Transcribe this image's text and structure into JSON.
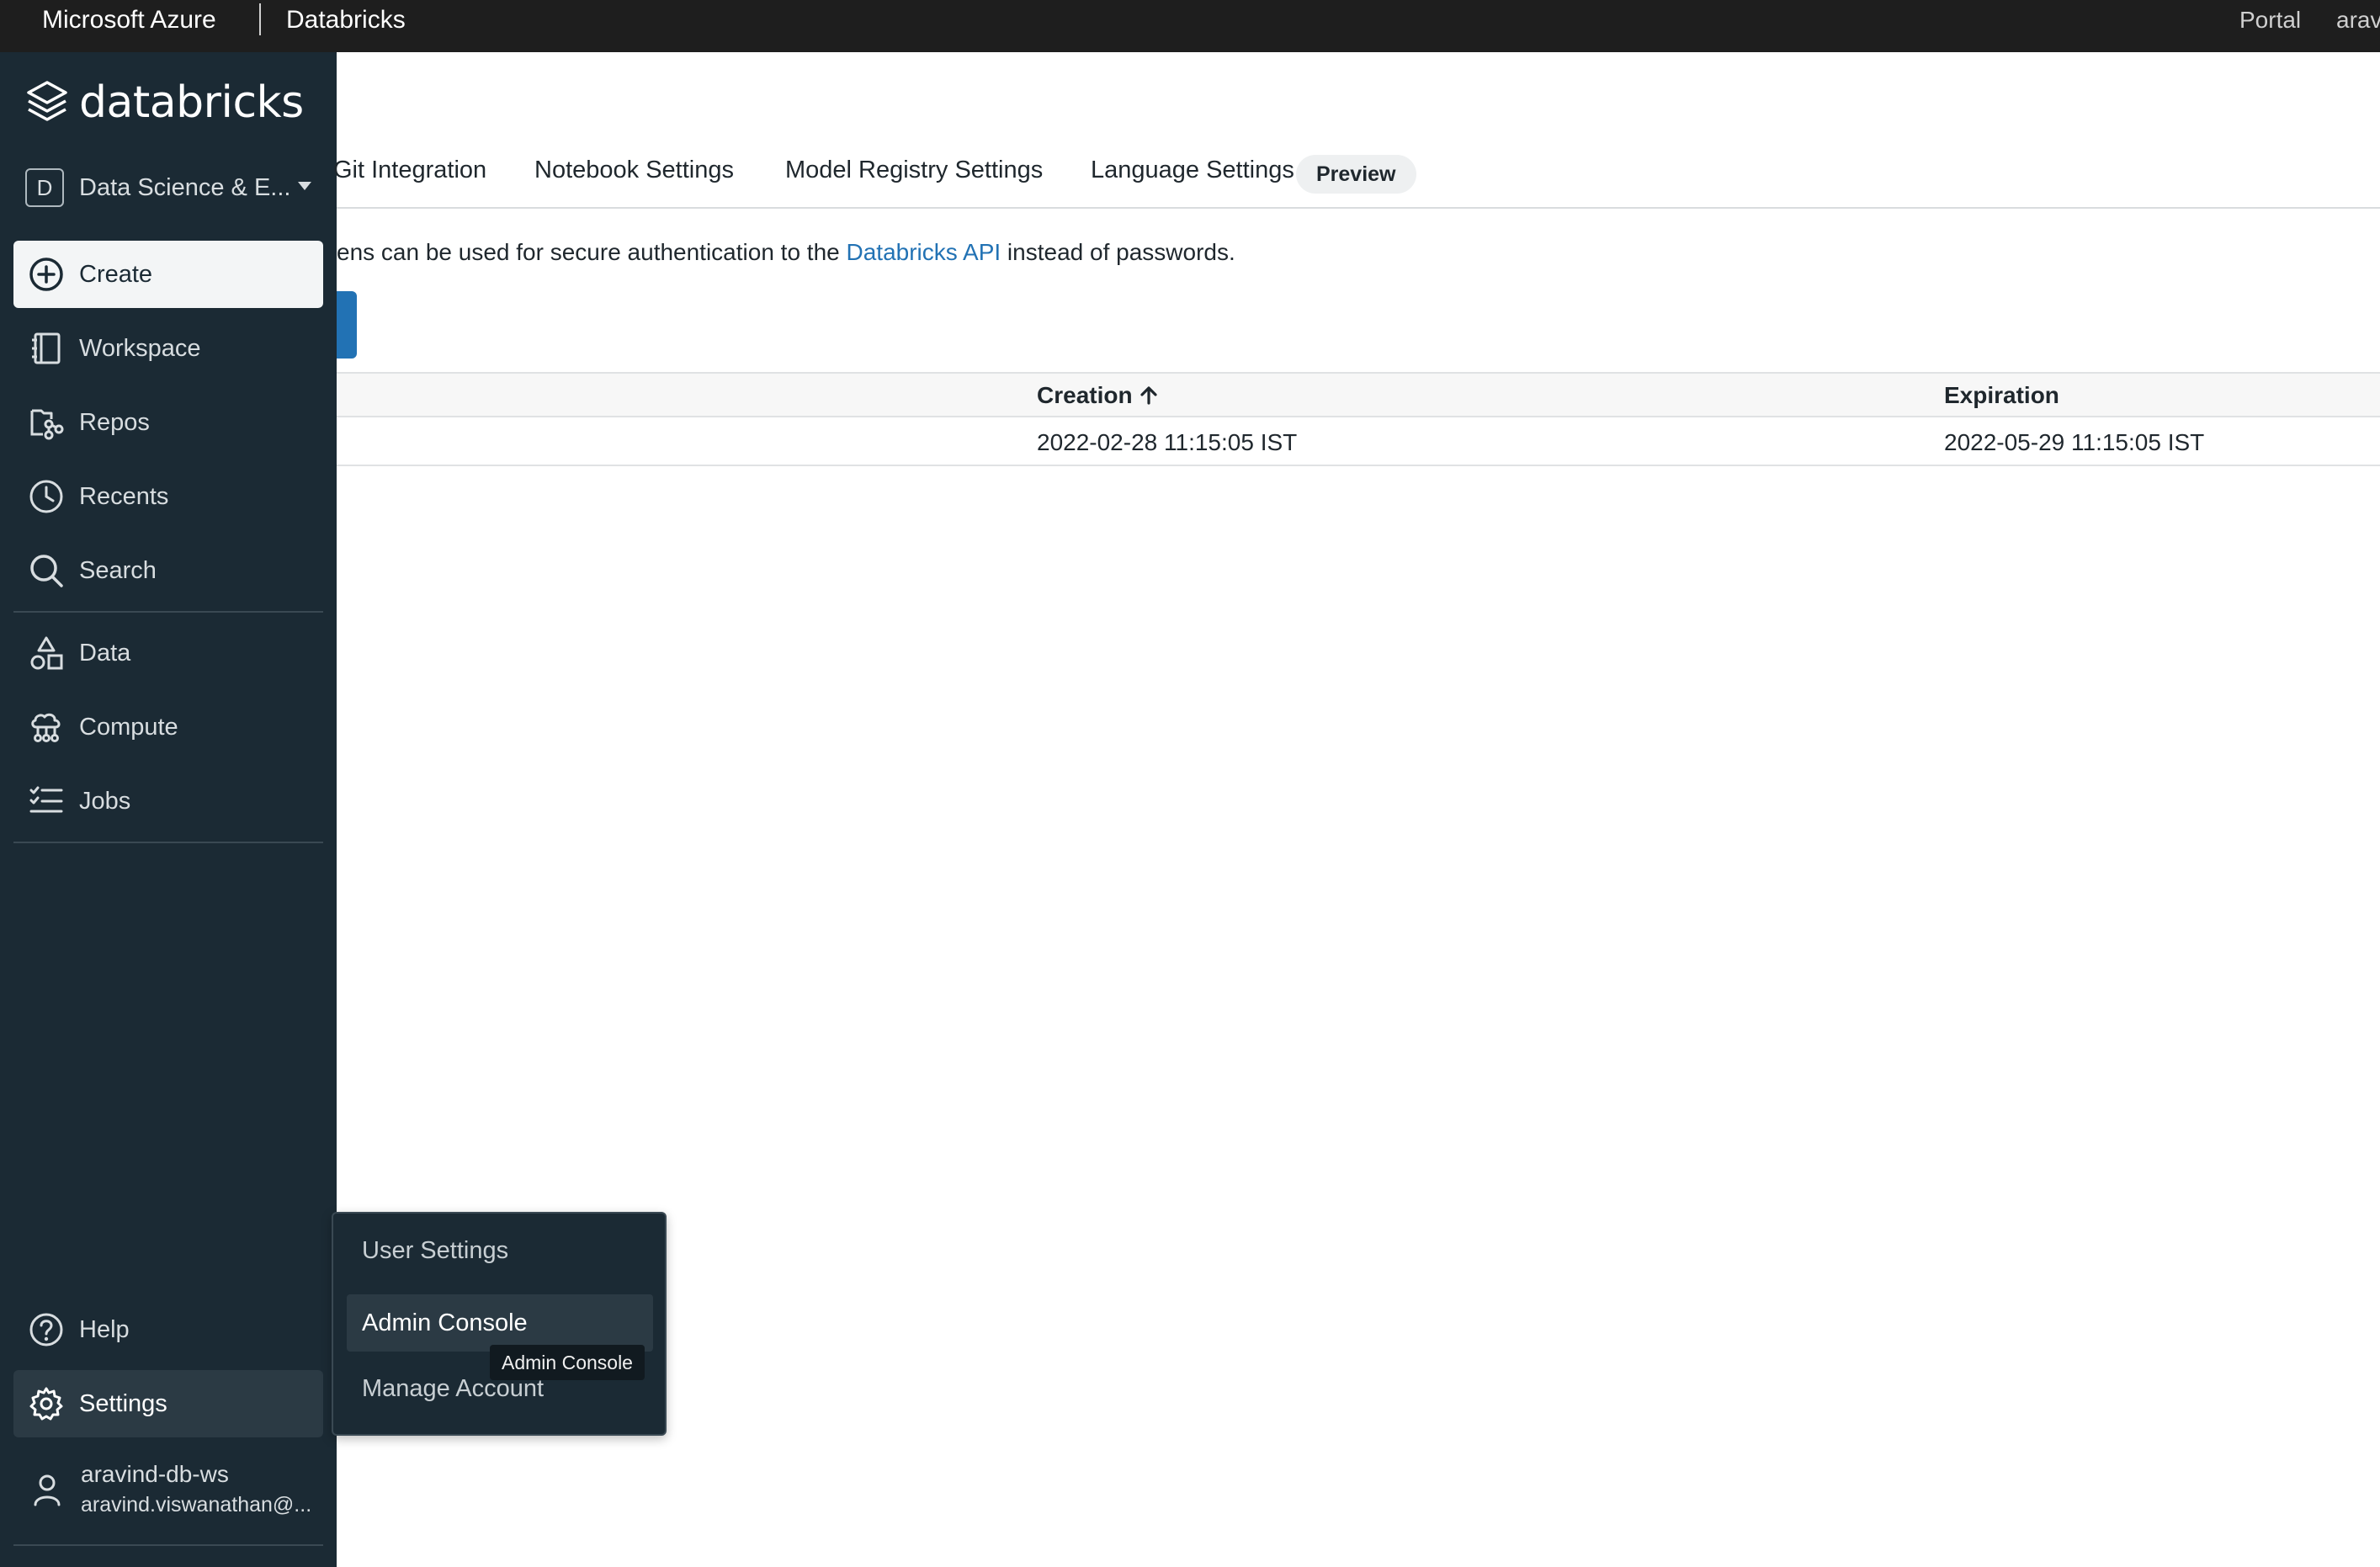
{
  "topbar": {
    "brand": "Microsoft Azure",
    "product": "Databricks",
    "portal_link": "Portal",
    "user_short": "arav"
  },
  "sidebar": {
    "logo_text": "databricks",
    "persona": {
      "badge": "D",
      "label": "Data Science & E..."
    },
    "create_label": "Create",
    "items": [
      {
        "label": "Workspace",
        "icon": "workspace-icon"
      },
      {
        "label": "Repos",
        "icon": "repos-icon"
      },
      {
        "label": "Recents",
        "icon": "clock-icon"
      },
      {
        "label": "Search",
        "icon": "search-icon"
      },
      {
        "label": "Data",
        "icon": "data-shapes-icon"
      },
      {
        "label": "Compute",
        "icon": "cloud-compute-icon"
      },
      {
        "label": "Jobs",
        "icon": "jobs-list-icon"
      }
    ],
    "help_label": "Help",
    "settings_label": "Settings",
    "account": {
      "name": "aravind-db-ws",
      "email": "aravind.viswanathan@..."
    }
  },
  "tabs": {
    "git": "Git Integration",
    "notebook": "Notebook Settings",
    "model_registry": "Model Registry Settings",
    "language": "Language Settings",
    "preview_badge": "Preview"
  },
  "description": {
    "before": "ens can be used for secure authentication to the ",
    "link": "Databricks API",
    "after": " instead of passwords."
  },
  "table": {
    "headers": {
      "creation": "Creation",
      "expiration": "Expiration"
    },
    "rows": [
      {
        "creation": "2022-02-28 11:15:05 IST",
        "expiration": "2022-05-29 11:15:05 IST"
      }
    ]
  },
  "settings_menu": {
    "items": [
      "User Settings",
      "Admin Console",
      "Manage Account"
    ],
    "tooltip": "Admin Console"
  },
  "colors": {
    "sidebar_bg": "#1b2a34",
    "accent_blue": "#2272b4",
    "topbar_bg": "#1e1e1e"
  }
}
